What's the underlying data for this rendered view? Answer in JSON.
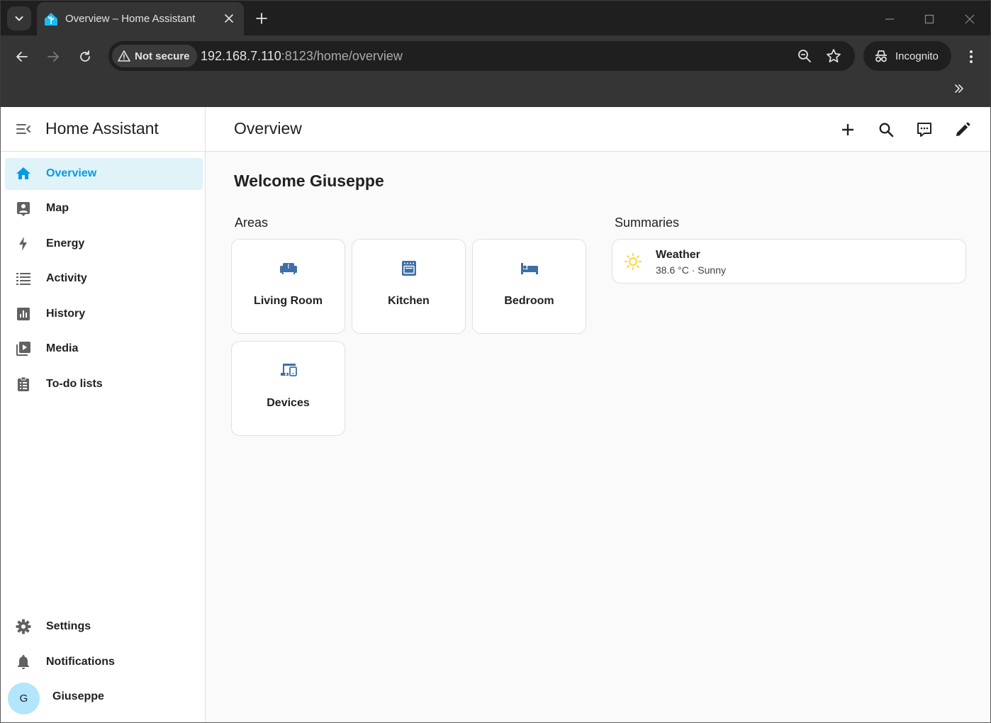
{
  "browser": {
    "tab": {
      "title": "Overview – Home Assistant"
    },
    "omnibox": {
      "security_label": "Not secure",
      "url_host": "192.168.7.110",
      "url_path": ":8123/home/overview"
    },
    "profile_label": "Incognito"
  },
  "sidebar": {
    "title": "Home Assistant",
    "items": [
      {
        "label": "Overview",
        "icon": "home-icon",
        "active": true
      },
      {
        "label": "Map",
        "icon": "map-icon"
      },
      {
        "label": "Energy",
        "icon": "lightning-bolt-icon"
      },
      {
        "label": "Activity",
        "icon": "activity-list-icon"
      },
      {
        "label": "History",
        "icon": "chart-box-icon"
      },
      {
        "label": "Media",
        "icon": "play-box-multiple-icon"
      },
      {
        "label": "To-do lists",
        "icon": "clipboard-list-icon"
      }
    ],
    "bottom": {
      "settings": "Settings",
      "notifications": "Notifications",
      "user_name": "Giuseppe",
      "user_initial": "G"
    }
  },
  "main": {
    "title": "Overview",
    "welcome": "Welcome Giuseppe",
    "areas_title": "Areas",
    "summaries_title": "Summaries",
    "areas": [
      {
        "label": "Living Room",
        "icon": "sofa-icon"
      },
      {
        "label": "Kitchen",
        "icon": "stove-icon"
      },
      {
        "label": "Bedroom",
        "icon": "bed-icon"
      },
      {
        "label": "Devices",
        "icon": "devices-icon"
      }
    ],
    "summaries": [
      {
        "name": "Weather",
        "state": "38.6 °C · Sunny",
        "icon": "weather-sunny-icon"
      }
    ]
  },
  "colors": {
    "accent": "#039be5",
    "area_icon": "#3f6fa6",
    "sunny": "#fdd835",
    "active_nav_bg": "#dff3f9"
  }
}
